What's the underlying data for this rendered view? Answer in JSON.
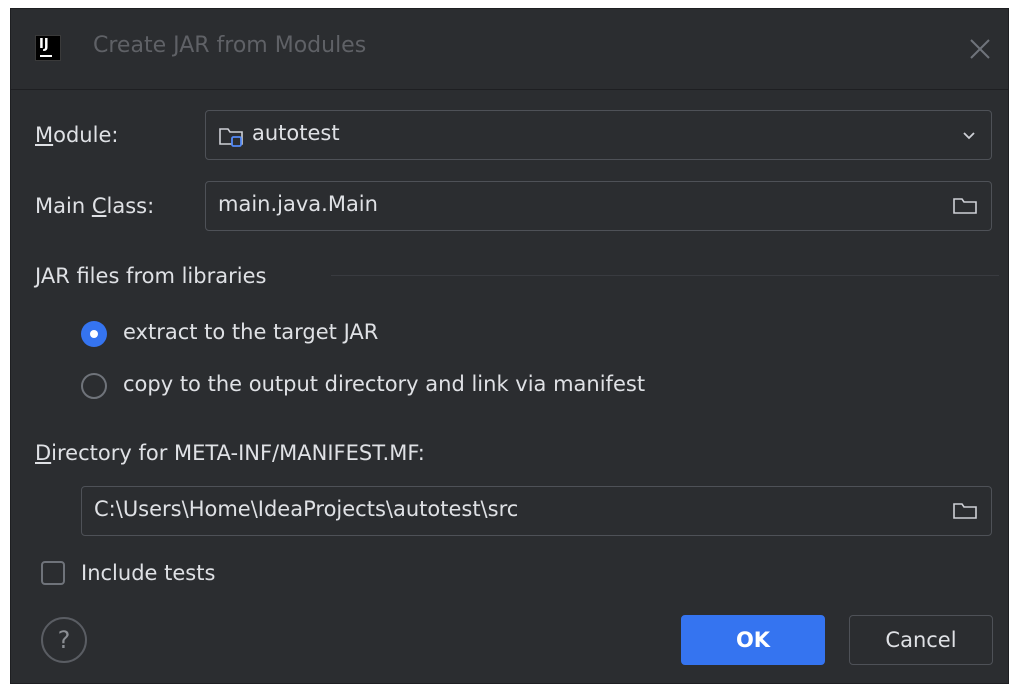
{
  "window": {
    "title": "Create JAR from Modules",
    "app_icon_text": "IJ"
  },
  "module": {
    "label_prefix": "",
    "label_mnemonic": "M",
    "label_rest": "odule:",
    "value": "autotest"
  },
  "main_class": {
    "label_prefix": "Main ",
    "label_mnemonic": "C",
    "label_rest": "lass:",
    "value": "main.java.Main"
  },
  "libraries": {
    "section_title": "JAR files from libraries",
    "options": [
      {
        "label": "extract to the target JAR",
        "selected": true
      },
      {
        "label": "copy to the output directory and link via manifest",
        "selected": false
      }
    ]
  },
  "manifest": {
    "label_mnemonic": "D",
    "label_rest": "irectory for META-INF/MANIFEST.MF:",
    "value": "C:\\Users\\Home\\IdeaProjects\\autotest\\src"
  },
  "include_tests": {
    "label": "Include tests",
    "checked": false
  },
  "buttons": {
    "help": "?",
    "ok": "OK",
    "cancel": "Cancel"
  },
  "colors": {
    "background": "#2b2d30",
    "accent": "#3574f0",
    "text": "#dfe1e5",
    "border": "#4e5157"
  },
  "icons": {
    "close": "close-icon",
    "module": "module-folder-icon",
    "dropdown": "chevron-down-icon",
    "browse": "folder-icon"
  }
}
